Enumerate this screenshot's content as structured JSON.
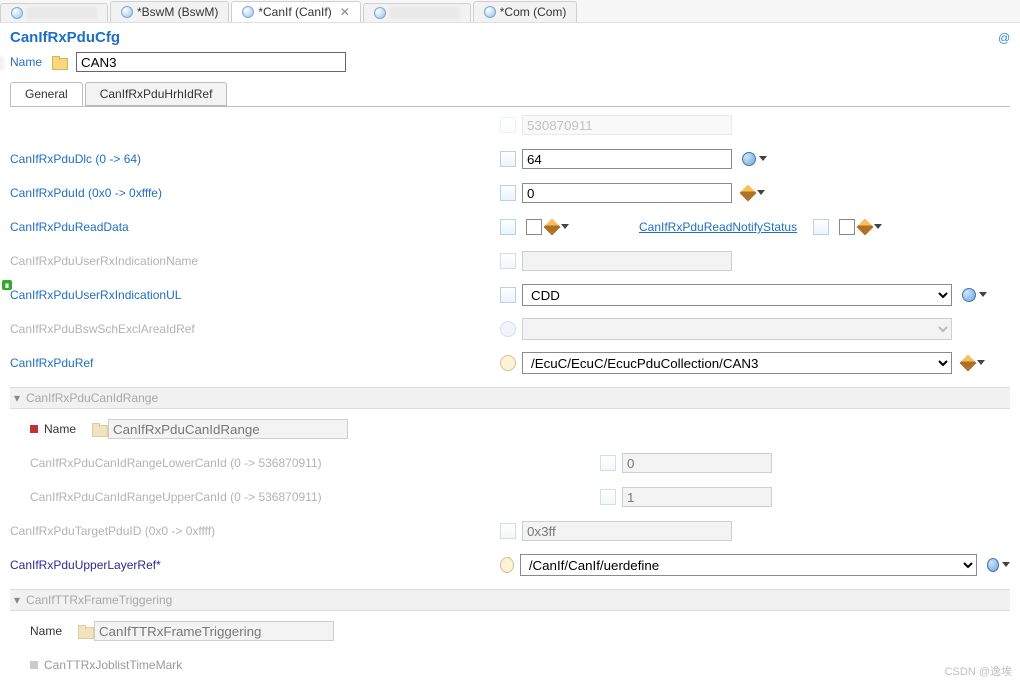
{
  "editor_tabs": [
    {
      "label": "",
      "modified": true,
      "hidden": true
    },
    {
      "label": "*BswM (BswM)",
      "modified": true
    },
    {
      "label": "*CanIf (CanIf)",
      "modified": true,
      "active": true,
      "closable": true
    },
    {
      "label": "",
      "modified": true,
      "hidden": true
    },
    {
      "label": "*Com (Com)",
      "modified": true
    }
  ],
  "page": {
    "title": "CanIfRxPduCfg",
    "atmark": "@"
  },
  "name_field": {
    "label": "Name",
    "value": "CAN3"
  },
  "sub_tabs": [
    {
      "label": "General",
      "active": true
    },
    {
      "label": "CanIfRxPduHrhIdRef",
      "active": false
    }
  ],
  "top_hidden_row": {
    "label": "",
    "value": "530870911"
  },
  "fields": {
    "dlc": {
      "label": "CanIfRxPduDlc (0 -> 64)",
      "value": "64"
    },
    "id": {
      "label": "CanIfRxPduId (0x0 -> 0xfffe)",
      "value": "0"
    },
    "readData": {
      "label": "CanIfRxPduReadData"
    },
    "readNotify": {
      "label": "CanIfRxPduReadNotifyStatus"
    },
    "userRxIndName": {
      "label": "CanIfRxPduUserRxIndicationName",
      "value": ""
    },
    "userRxIndUL": {
      "label": "CanIfRxPduUserRxIndicationUL",
      "value": "CDD"
    },
    "bswExcl": {
      "label": "CanIfRxPduBswSchExclAreaIdRef",
      "value": ""
    },
    "pduRef": {
      "label": "CanIfRxPduRef",
      "value": "/EcuC/EcuC/EcucPduCollection/CAN3"
    },
    "targetPduId": {
      "label": "CanIfRxPduTargetPduID (0x0 -> 0xffff)",
      "value": "0x3ff"
    },
    "upperLayerRef": {
      "label": "CanIfRxPduUpperLayerRef*",
      "value": "/CanIf/CanIf/uerdefine"
    }
  },
  "canIdRange": {
    "section": "CanIfRxPduCanIdRange",
    "name_label": "Name",
    "name_value": "CanIfRxPduCanIdRange",
    "lower": {
      "label": "CanIfRxPduCanIdRangeLowerCanId (0 -> 536870911)",
      "value": "0"
    },
    "upper": {
      "label": "CanIfRxPduCanIdRangeUpperCanId (0 -> 536870911)",
      "value": "1"
    }
  },
  "ttrx": {
    "section": "CanIfTTRxFrameTriggering",
    "name_label": "Name",
    "name_value": "CanIfTTRxFrameTriggering",
    "joblist_label": "CanTTRxJoblistTimeMark"
  },
  "watermark": "CSDN @逸埃"
}
